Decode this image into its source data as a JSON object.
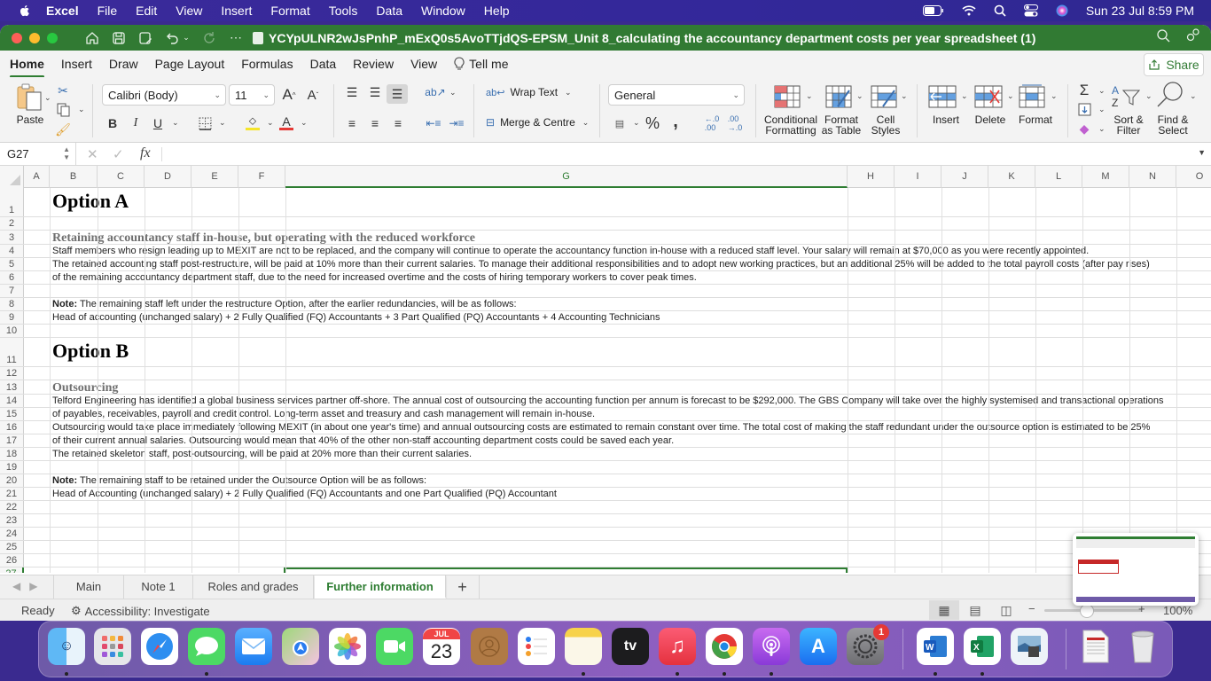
{
  "menubar": {
    "app": "Excel",
    "items": [
      "File",
      "Edit",
      "View",
      "Insert",
      "Format",
      "Tools",
      "Data",
      "Window",
      "Help"
    ],
    "clock": "Sun 23 Jul  8:59 PM",
    "status_icons": [
      "battery-icon",
      "wifi-icon",
      "spotlight-search-icon",
      "control-center-icon",
      "siri-icon"
    ]
  },
  "window": {
    "title": "YCYpULNR2wJsPnhP_mExQ0s5AvoTTjdQS-EPSM_Unit 8_calculating the accountancy department costs per year spreadsheet (1)"
  },
  "ribbon_tabs": [
    "Home",
    "Insert",
    "Draw",
    "Page Layout",
    "Formulas",
    "Data",
    "Review",
    "View"
  ],
  "active_ribbon_tab": "Home",
  "tell_me": "Tell me",
  "share_label": "Share",
  "ribbon": {
    "paste": "Paste",
    "font_name": "Calibri (Body)",
    "font_size": "11",
    "bold": "B",
    "italic": "I",
    "underline": "U",
    "wrap_text": "Wrap Text",
    "merge_centre": "Merge & Centre",
    "number_format": "General",
    "percent": "%",
    "comma": ",",
    "conditional_formatting": [
      "Conditional",
      "Formatting"
    ],
    "format_as_table": [
      "Format",
      "as Table"
    ],
    "cell_styles": [
      "Cell",
      "Styles"
    ],
    "insert": "Insert",
    "delete": "Delete",
    "format": "Format",
    "sort_filter": [
      "Sort &",
      "Filter"
    ],
    "find_select": [
      "Find &",
      "Select"
    ],
    "colors": {
      "highlight": "#f5e52a",
      "font_color": "#e53935",
      "accent": "#2e7d32"
    }
  },
  "formula_bar": {
    "name_box": "G27",
    "formula": ""
  },
  "columns": [
    "A",
    "B",
    "C",
    "D",
    "E",
    "F",
    "G",
    "H",
    "I",
    "J",
    "K",
    "L",
    "M",
    "N",
    "O"
  ],
  "selected_column": "G",
  "selected_cell": "G27",
  "rows": [
    {
      "n": "1",
      "text": "Option A",
      "style": "h1"
    },
    {
      "n": "2",
      "text": ""
    },
    {
      "n": "3",
      "text": "Retaining accountancy staff in-house, but operating with the reduced workforce",
      "style": "h2"
    },
    {
      "n": "4",
      "text": "Staff members who resign leading up to MEXIT are not to be replaced, and the company will continue to operate the accountancy function in-house with a reduced staff level. Your salary will remain at $70,000 as you were recently appointed."
    },
    {
      "n": "5",
      "text": "The retained accounting staff post-restructure, will be paid at 10% more than their current salaries. To manage their additional responsibilities and to adopt new working practices, but an additional 25% will be added to the total payroll costs (after pay rises)"
    },
    {
      "n": "6",
      "text": "of the remaining accountancy department staff, due to the need for increased overtime and the costs of hiring temporary workers to cover peak times."
    },
    {
      "n": "7",
      "text": ""
    },
    {
      "n": "8",
      "bold": "Note:",
      "text": " The remaining staff left under the restructure Option, after the earlier redundancies, will be as follows:"
    },
    {
      "n": "9",
      "text": "Head of accounting (unchanged salary) + 2 Fully Qualified (FQ) Accountants + 3 Part Qualified (PQ) Accountants + 4 Accounting Technicians"
    },
    {
      "n": "10",
      "text": ""
    },
    {
      "n": "11",
      "text": "Option B",
      "style": "h1"
    },
    {
      "n": "12",
      "text": ""
    },
    {
      "n": "13",
      "text": "Outsourcing",
      "style": "h2"
    },
    {
      "n": "14",
      "text": "Telford Engineering has identified a global business services partner off-shore. The annual cost of outsourcing the accounting function per annum is forecast to be $292,000. The GBS Company will take over the highly systemised and transactional operations"
    },
    {
      "n": "15",
      "text": "of payables, receivables, payroll and credit control. Long-term asset and treasury and cash management will remain in-house."
    },
    {
      "n": "16",
      "text": "Outsourcing would take place immediately following MEXIT (in about one year's time) and annual outsourcing costs are estimated to remain constant over time. The total cost of making the staff redundant under the outsource option is estimated to be 25%"
    },
    {
      "n": "17",
      "text": "of their current annual salaries. Outsourcing would mean that 40% of the other non-staff accounting department costs could be saved each year."
    },
    {
      "n": "18",
      "text": "The retained skeleton staff, post-outsourcing, will be paid at 20% more than their current salaries."
    },
    {
      "n": "19",
      "text": ""
    },
    {
      "n": "20",
      "bold": "Note:",
      "text": " The remaining staff to be retained under the Outsource Option will be as follows:"
    },
    {
      "n": "21",
      "text": "Head of Accounting (unchanged salary) + 2 Fully Qualified (FQ) Accountants and one Part Qualified (PQ) Accountant"
    },
    {
      "n": "22",
      "text": ""
    },
    {
      "n": "23",
      "text": ""
    },
    {
      "n": "24",
      "text": ""
    },
    {
      "n": "25",
      "text": ""
    },
    {
      "n": "26",
      "text": ""
    },
    {
      "n": "27",
      "text": ""
    }
  ],
  "sheet_tabs": [
    "Main",
    "Note 1",
    "Roles and grades",
    "Further information"
  ],
  "active_sheet": "Further information",
  "add_sheet": "+",
  "status": {
    "ready": "Ready",
    "accessibility": "Accessibility: Investigate",
    "zoom": "100%"
  },
  "dock": {
    "apps": [
      "Finder",
      "Launchpad",
      "Safari",
      "Messages",
      "Mail",
      "Maps",
      "Photos",
      "FaceTime",
      "Calendar",
      "Contacts",
      "Reminders",
      "Notes",
      "Apple TV",
      "Music",
      "Chrome",
      "Podcasts",
      "App Store",
      "System Settings",
      "Word",
      "Excel",
      "Preview",
      "Document",
      "Trash"
    ],
    "calendar_month": "JUL",
    "calendar_day": "23",
    "settings_badge": "1"
  }
}
